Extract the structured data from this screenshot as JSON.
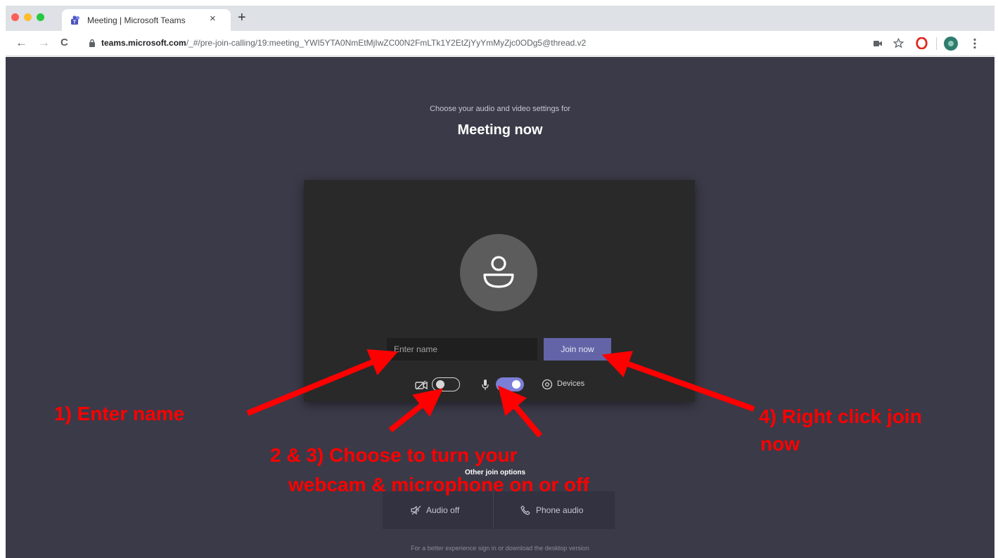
{
  "browser": {
    "tab_title": "Meeting | Microsoft Teams",
    "tab_close": "×",
    "new_tab": "+",
    "url_host": "teams.microsoft.com",
    "url_path": "/_#/pre-join-calling/19:meeting_YWI5YTA0NmEtMjIwZC00N2FmLTk1Y2EtZjYyYmMyZjc0ODg5@thread.v2",
    "nav": {
      "back": "←",
      "forward": "→",
      "reload": "C"
    },
    "colors": {
      "close": "#ff5f57",
      "minimize": "#febc2e",
      "maximize": "#28c840",
      "opera": "#e0241b",
      "profile": "#2e7d6e"
    }
  },
  "prejoin": {
    "subtitle": "Choose your audio and video settings for",
    "meeting_title": "Meeting now",
    "name_placeholder": "Enter name",
    "join_button": "Join now",
    "camera_toggle_on": false,
    "mic_toggle_on": true,
    "devices_label": "Devices"
  },
  "other_options": {
    "title": "Other join options",
    "audio_off": "Audio off",
    "phone_audio": "Phone audio"
  },
  "footer": {
    "text": "For a better experience sign in or download the desktop version"
  },
  "annotations": {
    "step1": "1) Enter name",
    "step23_line1": "2 & 3) Choose to turn your",
    "step23_line2": "webcam & microphone on or off",
    "step4_line1": "4) Right click join",
    "step4_line2": "now",
    "color": "#ff0000"
  }
}
